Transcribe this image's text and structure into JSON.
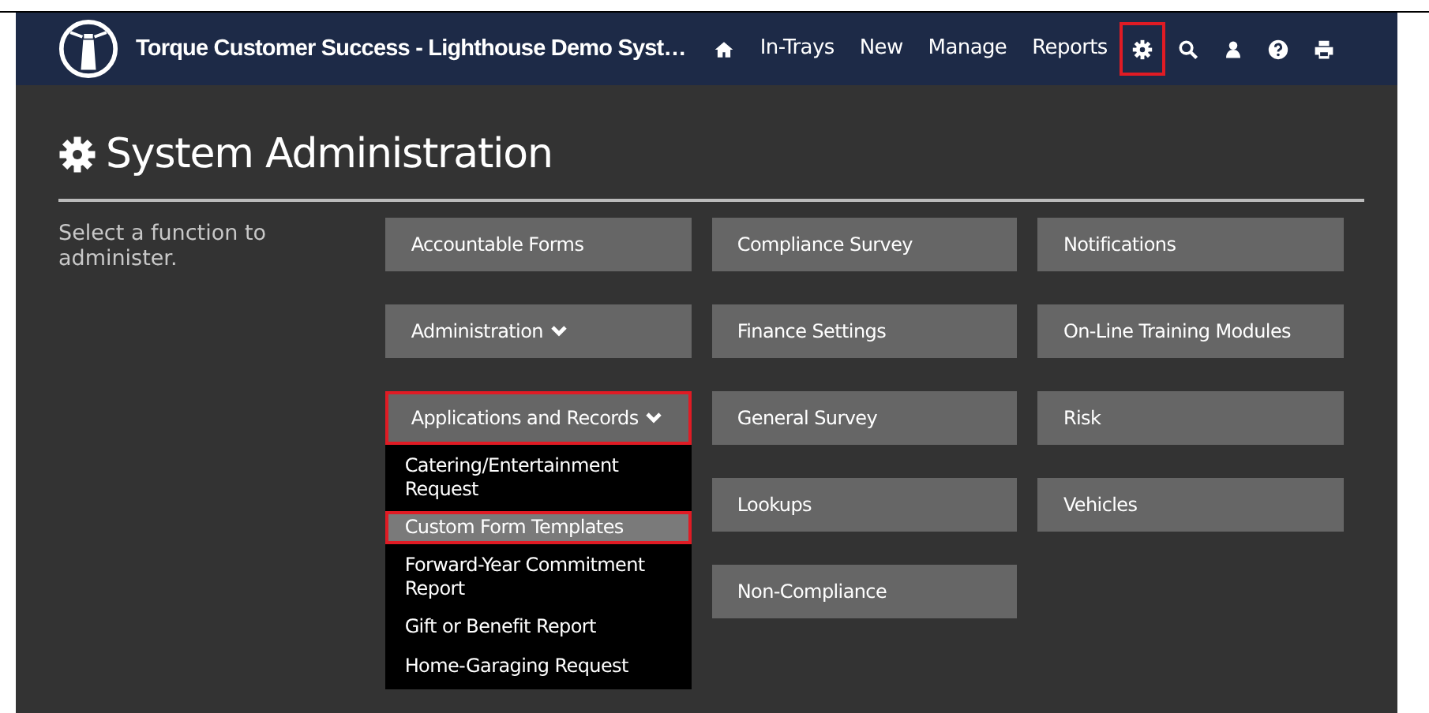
{
  "navbar": {
    "title": "Torque Customer Success - Lighthouse Demo Syst…",
    "items": [
      {
        "kind": "home",
        "highlighted": false
      },
      {
        "kind": "link",
        "label": "In-Trays",
        "highlighted": false
      },
      {
        "kind": "link",
        "label": "New",
        "highlighted": false
      },
      {
        "kind": "link",
        "label": "Manage",
        "highlighted": false
      },
      {
        "kind": "link",
        "label": "Reports",
        "highlighted": false
      },
      {
        "kind": "gear",
        "highlighted": true
      },
      {
        "kind": "search",
        "highlighted": false
      },
      {
        "kind": "user",
        "highlighted": false
      },
      {
        "kind": "help",
        "highlighted": false
      },
      {
        "kind": "print",
        "highlighted": false
      }
    ]
  },
  "page": {
    "title": "System Administration",
    "instructions": "Select a function to administer."
  },
  "columns": [
    [
      {
        "label": "Accountable Forms",
        "highlighted": false
      },
      {
        "label": "Administration",
        "dropdown": true,
        "highlighted": false
      },
      {
        "label": "Applications and Records",
        "dropdown": true,
        "highlighted": true,
        "submenu": [
          {
            "label": "Catering/Entertainment Request",
            "highlighted": false
          },
          {
            "label": "Custom Form Templates",
            "highlighted": true
          },
          {
            "label": "Forward-Year Commitment Report",
            "highlighted": false
          },
          {
            "label": "Gift or Benefit Report",
            "highlighted": false
          },
          {
            "label": "Home-Garaging Request",
            "highlighted": false
          }
        ]
      }
    ],
    [
      {
        "label": "Compliance Survey",
        "highlighted": false
      },
      {
        "label": "Finance Settings",
        "highlighted": false
      },
      {
        "label": "General Survey",
        "highlighted": false
      },
      {
        "label": "Lookups",
        "highlighted": false
      },
      {
        "label": "Non-Compliance",
        "highlighted": false
      }
    ],
    [
      {
        "label": "Notifications",
        "highlighted": false
      },
      {
        "label": "On-Line Training Modules",
        "highlighted": false
      },
      {
        "label": "Risk",
        "highlighted": false
      },
      {
        "label": "Vehicles",
        "highlighted": false
      }
    ]
  ]
}
